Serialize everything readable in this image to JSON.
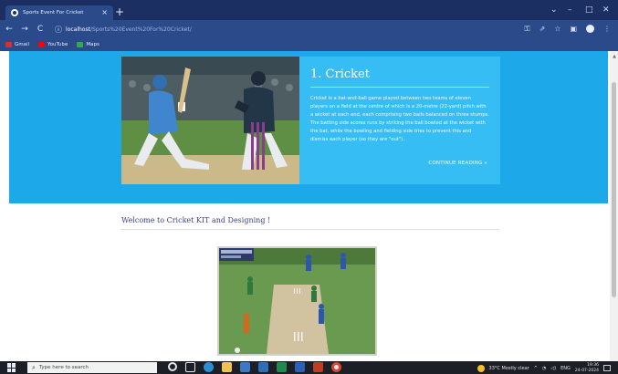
{
  "browser": {
    "tab_title": "Sports Event For Cricket",
    "tab_close": "×",
    "new_tab": "+",
    "url_host": "localhost",
    "url_path": "/Sports%20Event%20For%20Cricket/",
    "nav": {
      "back": "←",
      "forward": "→",
      "reload": "C"
    },
    "window_controls": {
      "chevron": "⌄",
      "minimize": "–",
      "maximize": "□",
      "close": "✕"
    },
    "bookmarks": [
      {
        "label": "Gmail",
        "color": "#d93025"
      },
      {
        "label": "YouTube",
        "color": "#ff0000"
      },
      {
        "label": "Maps",
        "color": "#34a853"
      }
    ]
  },
  "hero": {
    "heading": "1. Cricket",
    "body": "Cricket is a bat-and-ball game played between two teams of eleven players on a field at the centre of which is a 20-metre (22-yard) pitch with a wicket at each end, each comprising two bails balanced on three stumps. The batting side scores runs by striking the ball bowled at the wicket with the bat, while the bowling and fielding side tries to prevent this and dismiss each player (so they are \"out\").",
    "more_link": "CONTINUE READING »",
    "background_color": "#1da8ea",
    "card_color": "#36bdf4"
  },
  "welcome": {
    "text": "Welcome to Cricket KIT and Designing !",
    "color": "#3b3f87"
  },
  "taskbar": {
    "search_placeholder": "Type here to search",
    "weather": "33°C  Mostly clear",
    "lang": "ENG",
    "time": "19:36",
    "date": "24-07-2024"
  }
}
